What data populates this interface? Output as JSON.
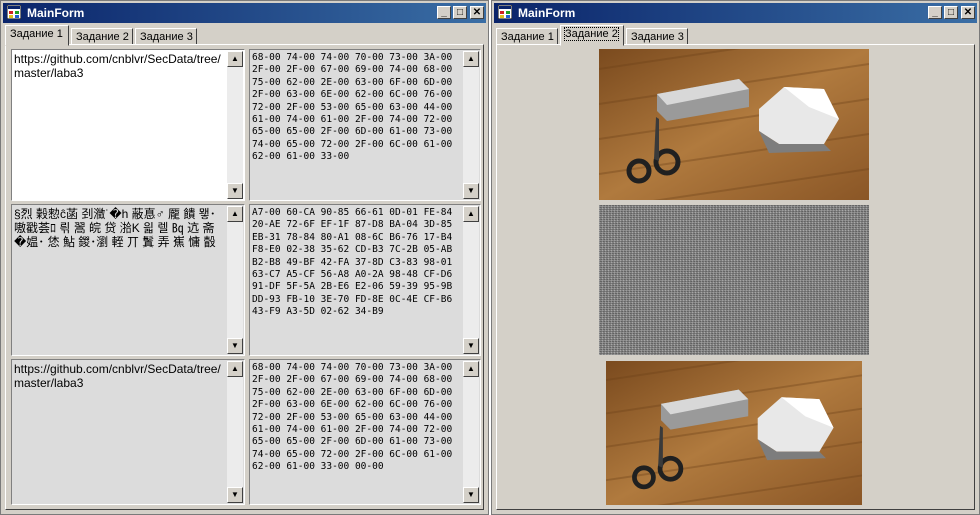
{
  "left_window": {
    "title": "MainForm",
    "tabs": [
      "Задание 1",
      "Задание 2",
      "Задание 3"
    ],
    "active_tab": "Задание 1",
    "row1": {
      "text": "https://github.com/cnblvr/SecData/tree/master/laba3",
      "hex": "68-00 74-00 74-00 70-00 73-00 3A-00 2F-00 2F-00 67-00 69-00 74-00 68-00 75-00 62-00 2E-00 63-00 6F-00 6D-00 2F-00 63-00 6E-00 62-00 6C-00 76-00 72-00 2F-00 53-00 65-00 63-00 44-00 61-00 74-00 61-00 2F-00 74-00 72-00 65-00 65-00 2F-00 6D-00 61-00 73-00 74-00 65-00 72-00 2F-00 6C-00 61-00 62-00 61-00 33-00"
    },
    "row2": {
      "text": "§烈 榖愸ĉ菡 刭瀓˙�h 蔽惪♂ 龎 饋 뫻･嗷戳荟ﾛ 릒 翯 皖 贷 湁K 읣 렐 ㏃ 迒 斋�媪･ 恷 鮎 鍐･瀏 輊 丌 鬒 弄 嶣 慵 瞉",
      "hex": "A7-00 60-CA 90-85 66-61 0D-01 FE-84 20-AE 72-6F EF-1F 87-D8 BA-04 3D-85 EB-31 78-84 80-A1 08-6C B6-76 17-B4 F8-E0 02-38 35-62 CD-B3 7C-2B 05-AB B2-B8 49-BF 42-FA 37-8D C3-83 98-01 63-C7 A5-CF 56-A8 A0-2A 98-48 CF-D6 91-DF 5F-5A 2B-E6 E2-06 59-39 95-9B DD-93 FB-10 3E-70 FD-8E 0C-4E CF-B6 43-F9 A3-5D 02-62 34-B9"
    },
    "row3": {
      "text": "https://github.com/cnblvr/SecData/tree/master/laba3",
      "hex": "68-00 74-00 74-00 70-00 73-00 3A-00 2F-00 2F-00 67-00 69-00 74-00 68-00 75-00 62-00 2E-00 63-00 6F-00 6D-00 2F-00 63-00 6E-00 62-00 6C-00 76-00 72-00 2F-00 53-00 65-00 63-00 44-00 61-00 74-00 61-00 2F-00 74-00 72-00 65-00 65-00 2F-00 6D-00 61-00 73-00 74-00 65-00 72-00 2F-00 6C-00 61-00 62-00 61-00 33-00 00-00"
    }
  },
  "right_window": {
    "title": "MainForm",
    "tabs": [
      "Задание 1",
      "Задание 2",
      "Задание 3"
    ],
    "active_tab": "Задание 2"
  },
  "window_controls": {
    "minimize": "_",
    "maximize": "□",
    "close": "✕"
  },
  "scroll_icons": {
    "up": "▲",
    "down": "▼"
  }
}
